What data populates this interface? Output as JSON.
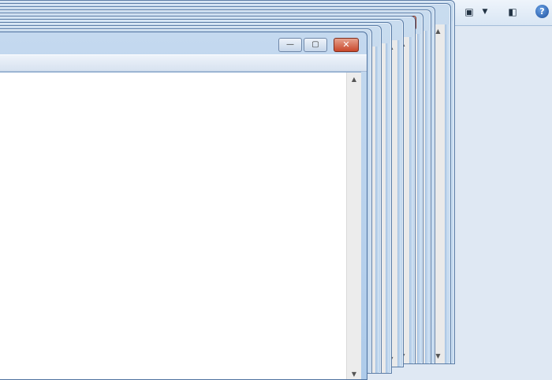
{
  "toolbar": {
    "icons": [
      "picture-icon",
      "dropdown-arrow-icon",
      "pane-icon",
      "help-icon"
    ],
    "help_glyph": "?"
  },
  "windows": {
    "minimize_glyph": "—",
    "maximize_glyph": "▢",
    "close_glyph": "✕",
    "scroll_up_glyph": "▲",
    "scroll_down_glyph": "▼"
  }
}
